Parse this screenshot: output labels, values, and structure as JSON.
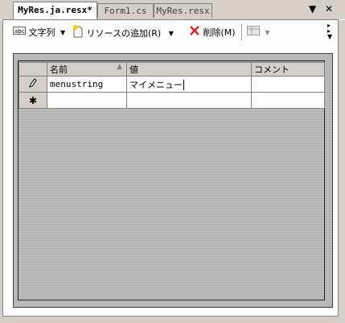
{
  "tabs": [
    {
      "label": "MyRes.ja.resx*",
      "active": true
    },
    {
      "label": "Form1.cs",
      "active": false
    },
    {
      "label": "MyRes.resx",
      "active": false
    }
  ],
  "tab_controls": {
    "dropdown_icon": "▼",
    "close_icon": "✕"
  },
  "toolbar": {
    "strings_label": "文字列",
    "add_resource_label": "リソースの追加(R)",
    "delete_label": "削除(M)"
  },
  "grid": {
    "columns": [
      "名前",
      "値",
      "コメント"
    ],
    "rows": [
      {
        "indicator": "pencil",
        "name": "menustring",
        "value": "マイメニュー",
        "comment": ""
      },
      {
        "indicator": "new-row",
        "name": "",
        "value": "",
        "comment": ""
      }
    ],
    "new_row_glyph": "✱"
  },
  "colors": {
    "chrome": "#d4d0c8",
    "panel": "#fdfdfd",
    "delete_x": "#e02020"
  }
}
